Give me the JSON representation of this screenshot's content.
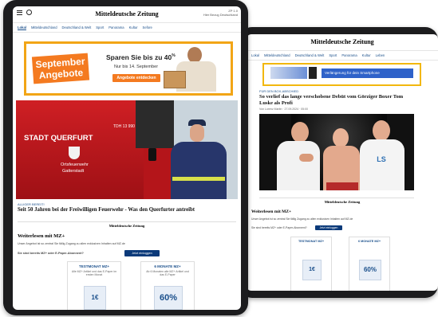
{
  "left": {
    "header": {
      "brand": "Mitteldeutsche Zeitung",
      "sub1": "ZP 1.0",
      "sub2": "Hier Bezug Deutschland"
    },
    "nav": [
      "Lokal",
      "Mitteldeutschland",
      "Deutschland & Welt",
      "Sport",
      "Panorama",
      "Kultur",
      "Sefore"
    ],
    "ad": {
      "title1": "September",
      "title2": "Angebote",
      "headline_prefix": "Sparen Sie bis zu 40",
      "headline_suffix": "%",
      "subline": "Nur bis 14. September",
      "button": "Angebote entdecken"
    },
    "photo": {
      "truck_text": "STADT QUERFURT",
      "truck_sub1": "Ortsfeuerwehr",
      "truck_sub2": "Gatterstadt",
      "plate": "TDH 13 990"
    },
    "article": {
      "kicker": "ALLIGER BEREIT!",
      "title": "Seit 50 Jahren bei der Freiwilligen Feuerwehr - Was den Querfurter antreibt"
    },
    "brand_mid": "Mitteldeutsche Zeitung",
    "promo": {
      "title": "Weiterlesen mit MZ+",
      "text": "Unser Angebot ist so zentral Sie fällig Zugang zu allen exklusiven Inhalten auf MZ.de",
      "question": "Sie sind bereits MZ+ oder E-Paper-Abonnent?",
      "login": "Jetzt einloggen",
      "card1_title": "TESTMONAT MZ+",
      "card1_desc": "Alle MZ+ Artikel und das E-Paper im ersten Monat",
      "card2_title": "6 MONATE MZ+",
      "card2_desc": "Ab 6 Monaten alle MZ+ Artikel und das E-Paper",
      "card2_badge": "60%",
      "card1_badge": "1€"
    }
  },
  "right": {
    "header": {
      "brand": "Mitteldeutsche Zeitung"
    },
    "nav": [
      "Lokal",
      "Mitteldeutschland",
      "Deutschland & Welt",
      "Sport",
      "Panorama",
      "Kultur",
      "Leben"
    ],
    "ad": {
      "text": "Verlängerung für dein Smartphone"
    },
    "article": {
      "kicker": "FÜR DEN BOX-ABSCHIED",
      "title": "So verlief das lange verschobene Debüt vom Görziger Boxer Tom Luske als Profi",
      "meta": "Von Lorenz Martin · 27.09.2024 · 05:00"
    },
    "shirt_text": "LS",
    "brand_mid": "Mitteldeutsche Zeitung",
    "promo": {
      "title": "Weiterlesen mit MZ+",
      "text": "Unser Angebot ist so zentral Sie fällig Zugang zu allen exklusiven Inhalten auf MZ.de",
      "question": "Sie sind bereits MZ+ oder E-Paper-Abonnent?",
      "login": "Jetzt einloggen",
      "card1_title": "TESTMONAT MZ+",
      "card2_title": "6 MONATE MZ+",
      "card2_badge": "60%",
      "card1_badge": "1€"
    }
  }
}
